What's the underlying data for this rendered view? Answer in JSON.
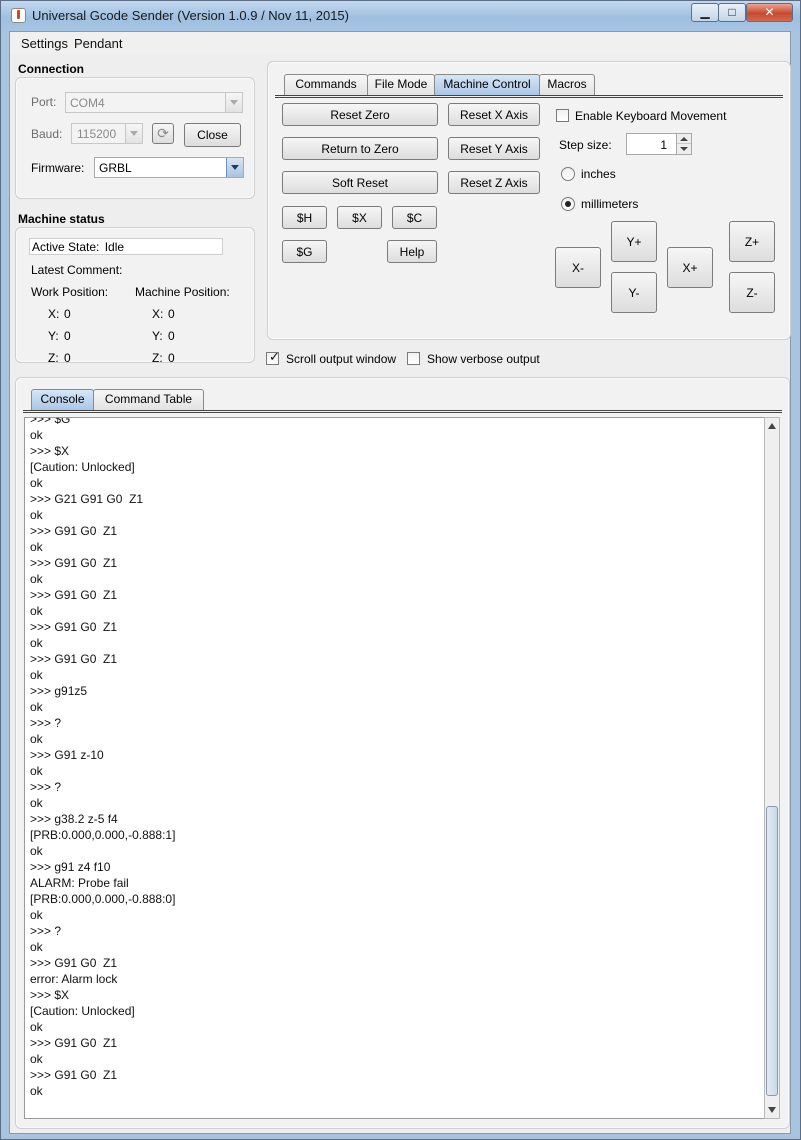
{
  "window": {
    "title": "Universal Gcode Sender (Version 1.0.9 / Nov 11, 2015)",
    "controls": {
      "minimize": "▁",
      "maximize": "□",
      "close": "✕"
    }
  },
  "menubar": {
    "items": [
      "Settings",
      "Pendant"
    ]
  },
  "connection": {
    "title": "Connection",
    "port_label": "Port:",
    "port_value": "COM4",
    "baud_label": "Baud:",
    "baud_value": "115200",
    "refresh_icon": "⟳",
    "close_button": "Close",
    "firmware_label": "Firmware:",
    "firmware_value": "GRBL"
  },
  "machine_status": {
    "title": "Machine status",
    "active_state_label": "Active State:",
    "active_state_value": "Idle",
    "latest_comment_label": "Latest Comment:",
    "work_position_label": "Work Position:",
    "machine_position_label": "Machine Position:",
    "work": {
      "x_label": "X:",
      "x": "0",
      "y_label": "Y:",
      "y": "0",
      "z_label": "Z:",
      "z": "0"
    },
    "machine": {
      "x_label": "X:",
      "x": "0",
      "y_label": "Y:",
      "y": "0",
      "z_label": "Z:",
      "z": "0"
    }
  },
  "control_tabs": [
    "Commands",
    "File Mode",
    "Machine Control",
    "Macros"
  ],
  "machine_control": {
    "reset_zero": "Reset Zero",
    "return_to_zero": "Return to Zero",
    "soft_reset": "Soft Reset",
    "reset_x": "Reset X Axis",
    "reset_y": "Reset Y Axis",
    "reset_z": "Reset Z Axis",
    "cmd_h": "$H",
    "cmd_x": "$X",
    "cmd_c": "$C",
    "cmd_g": "$G",
    "help": "Help",
    "enable_keyboard": "Enable Keyboard Movement",
    "step_size_label": "Step size:",
    "step_size_value": "1",
    "inches": "inches",
    "millimeters": "millimeters",
    "units_selected": "millimeters",
    "jog": {
      "x_minus": "X-",
      "x_plus": "X+",
      "y_plus": "Y+",
      "y_minus": "Y-",
      "z_plus": "Z+",
      "z_minus": "Z-"
    }
  },
  "options": {
    "scroll_output": "Scroll output window",
    "scroll_output_checked": true,
    "verbose_output": "Show verbose output",
    "verbose_output_checked": false
  },
  "console_tabs": [
    "Console",
    "Command Table"
  ],
  "console_lines": [
    ">>> $G",
    "ok",
    ">>> $X",
    "[Caution: Unlocked]",
    "ok",
    ">>> G21 G91 G0  Z1",
    "ok",
    ">>> G91 G0  Z1",
    "ok",
    ">>> G91 G0  Z1",
    "ok",
    ">>> G91 G0  Z1",
    "ok",
    ">>> G91 G0  Z1",
    "ok",
    ">>> G91 G0  Z1",
    "ok",
    ">>> g91z5",
    "ok",
    ">>> ?",
    "ok",
    ">>> G91 z-10",
    "ok",
    ">>> ?",
    "ok",
    ">>> g38.2 z-5 f4",
    "[PRB:0.000,0.000,-0.888:1]",
    "ok",
    ">>> g91 z4 f10",
    "ALARM: Probe fail",
    "[PRB:0.000,0.000,-0.888:0]",
    "ok",
    ">>> ?",
    "ok",
    ">>> G91 G0  Z1",
    "error: Alarm lock",
    ">>> $X",
    "[Caution: Unlocked]",
    "ok",
    ">>> G91 G0  Z1",
    "ok",
    ">>> G91 G0  Z1",
    "ok"
  ]
}
